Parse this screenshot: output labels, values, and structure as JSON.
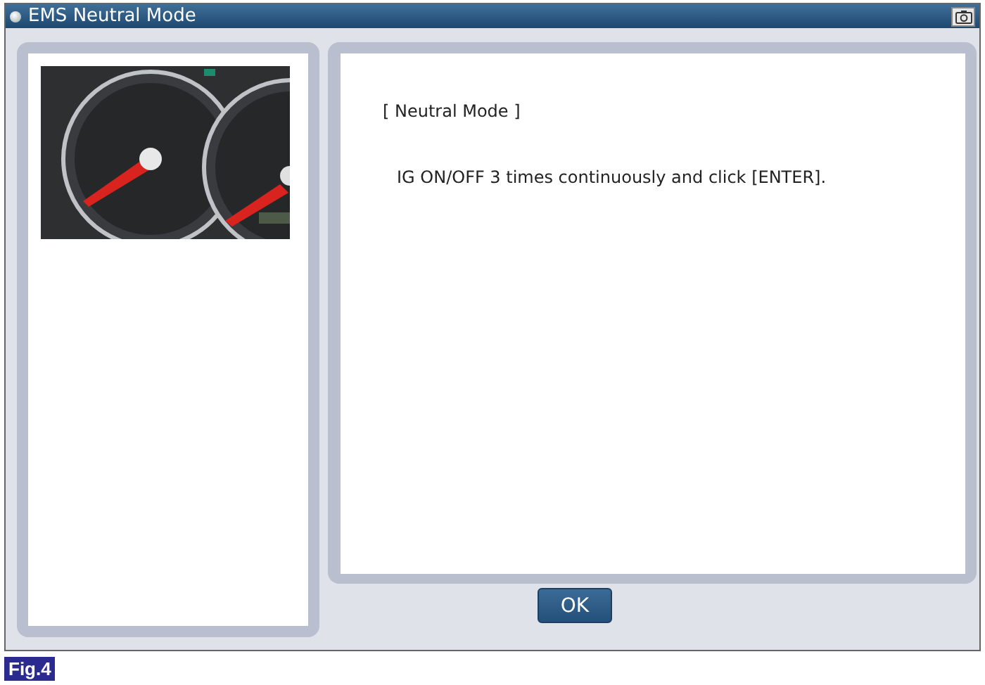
{
  "window": {
    "title": "EMS Neutral Mode"
  },
  "message": {
    "heading": "[ Neutral Mode ]",
    "instruction": "IG ON/OFF 3 times continuously and click [ENTER]."
  },
  "buttons": [
    "OK"
  ],
  "figure_label": "Fig.4"
}
